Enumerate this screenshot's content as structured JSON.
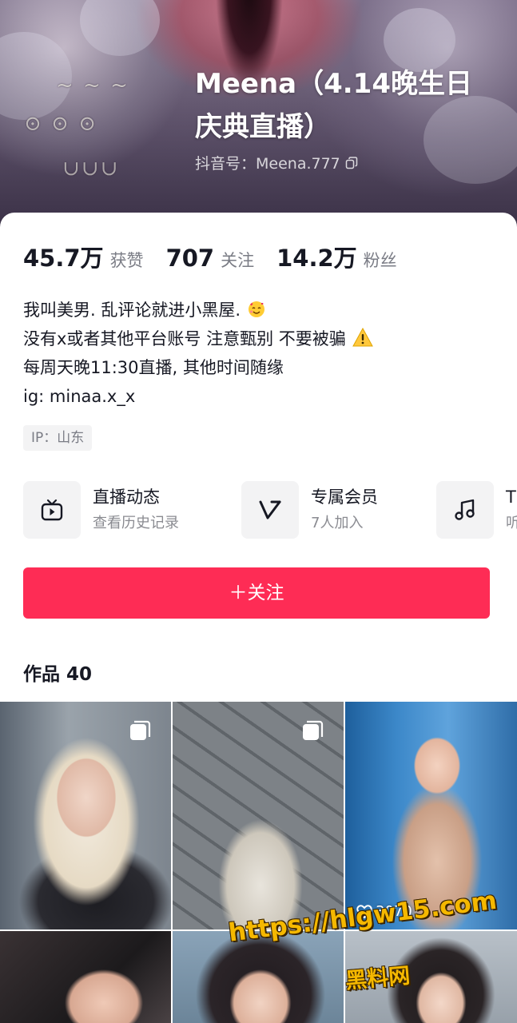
{
  "profile": {
    "name": "Meena（4.14晚生日庆典直播）",
    "name_line1": "Meena（4.14晚生日",
    "name_line2": "庆典直播）",
    "douyin_id": "抖音号：Meena.777"
  },
  "stats": [
    {
      "value": "45.7万",
      "label": "获赞"
    },
    {
      "value": "707",
      "label": "关注"
    },
    {
      "value": "14.2万",
      "label": "粉丝"
    }
  ],
  "bio": {
    "line1": "我叫美男. 乱评论就进小黑屋.",
    "line1_emoji": "smiling-face-with-hearts",
    "line2": "没有x或者其他平台账号 注意甄别 不要被骗",
    "line2_emoji": "warning",
    "line3": "每周天晚11:30直播, 其他时间随缘",
    "line4": "ig: minaa.x_x"
  },
  "ip": "IP：山东",
  "features": [
    {
      "title": "直播动态",
      "subtitle": "查看历史记录",
      "icon": "tv-icon"
    },
    {
      "title": "专属会员",
      "subtitle": "7人加入",
      "icon": "v-badge-icon"
    },
    {
      "title": "T",
      "subtitle": "听",
      "icon": "music-note-icon"
    }
  ],
  "follow_button": "＋关注",
  "works": {
    "title": "作品 40"
  },
  "videos": [
    {
      "multi": true
    },
    {
      "multi": true
    },
    {
      "likes": "3070"
    },
    {},
    {},
    {}
  ],
  "watermark": {
    "url": "https://hlgw15.com",
    "label": "黑料网"
  },
  "colors": {
    "accent": "#fe2c55",
    "text": "#161823",
    "secondary": "#7a7c85"
  }
}
